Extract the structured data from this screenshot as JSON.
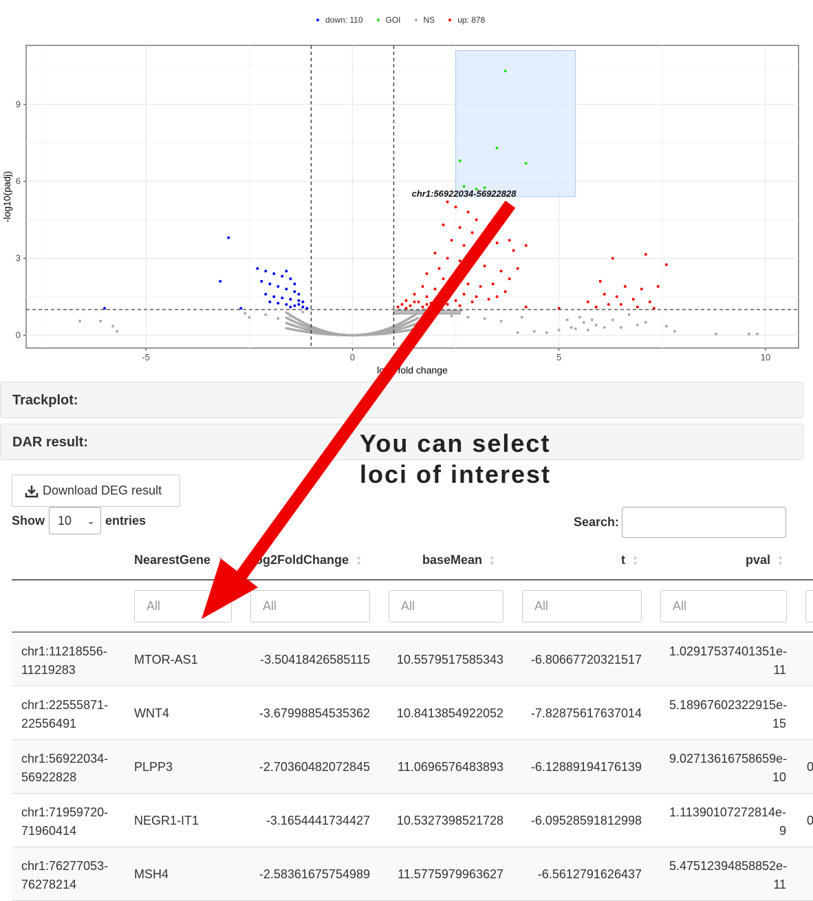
{
  "legend": [
    {
      "label": "down: 110",
      "color": "#0000ff"
    },
    {
      "label": "GOI",
      "color": "#22dd22"
    },
    {
      "label": "NS",
      "color": "#aaaaaa"
    },
    {
      "label": "up: 878",
      "color": "#ff0000"
    }
  ],
  "chart_data": {
    "type": "scatter",
    "xlabel": "log2 fold change",
    "ylabel": "-log10(padj)",
    "xlim": [
      -7.9,
      10.8
    ],
    "ylim": [
      -0.5,
      11.3
    ],
    "xticks": [
      -5,
      0,
      5,
      10
    ],
    "yticks": [
      0,
      3,
      6,
      9
    ],
    "grid": true,
    "thresholds": {
      "x": [
        -1,
        1
      ],
      "y": 1
    },
    "selection_box": {
      "x": [
        2.5,
        5.4
      ],
      "y": [
        5.4,
        11.1
      ]
    },
    "annotation": {
      "text": "chr1:56922034-56922828",
      "x": 2.7,
      "y": 5.4
    },
    "series": [
      {
        "name": "GOI",
        "color": "#22dd22",
        "points": [
          [
            3.7,
            10.3
          ],
          [
            3.5,
            7.3
          ],
          [
            2.6,
            6.8
          ],
          [
            4.2,
            6.7
          ],
          [
            2.7,
            5.8
          ],
          [
            3.0,
            5.7
          ],
          [
            3.2,
            5.75
          ]
        ]
      },
      {
        "name": "down: 110",
        "color": "#0000ff",
        "points": [
          [
            -3.0,
            3.8
          ],
          [
            -3.2,
            2.1
          ],
          [
            -6.0,
            1.05
          ],
          [
            -2.7,
            1.05
          ],
          [
            -2.3,
            2.6
          ],
          [
            -2.1,
            2.5
          ],
          [
            -1.9,
            2.4
          ],
          [
            -1.7,
            2.3
          ],
          [
            -1.5,
            2.2
          ],
          [
            -2.2,
            2.1
          ],
          [
            -2.0,
            2.0
          ],
          [
            -1.8,
            1.9
          ],
          [
            -1.6,
            1.8
          ],
          [
            -1.4,
            1.7
          ],
          [
            -2.1,
            1.6
          ],
          [
            -1.9,
            1.5
          ],
          [
            -1.7,
            1.45
          ],
          [
            -1.5,
            1.4
          ],
          [
            -1.3,
            1.35
          ],
          [
            -2.0,
            1.3
          ],
          [
            -1.8,
            1.25
          ],
          [
            -1.6,
            1.2
          ],
          [
            -1.4,
            1.15
          ],
          [
            -1.2,
            1.1
          ],
          [
            -1.1,
            1.05
          ],
          [
            -1.5,
            1.1
          ],
          [
            -1.3,
            1.2
          ],
          [
            -1.2,
            1.3
          ],
          [
            -1.6,
            2.5
          ],
          [
            -1.4,
            2.0
          ],
          [
            -1.3,
            1.6
          ]
        ]
      },
      {
        "name": "up: 878",
        "color": "#ff0000",
        "points": [
          [
            2.3,
            5.2
          ],
          [
            2.5,
            5.0
          ],
          [
            2.8,
            4.8
          ],
          [
            3.0,
            4.5
          ],
          [
            2.2,
            4.3
          ],
          [
            2.6,
            4.2
          ],
          [
            2.9,
            4.0
          ],
          [
            3.3,
            3.9
          ],
          [
            2.4,
            3.7
          ],
          [
            2.7,
            3.5
          ],
          [
            3.1,
            3.4
          ],
          [
            3.5,
            3.6
          ],
          [
            3.8,
            3.7
          ],
          [
            3.9,
            3.3
          ],
          [
            4.2,
            3.5
          ],
          [
            2.0,
            3.2
          ],
          [
            2.3,
            3.0
          ],
          [
            2.6,
            2.9
          ],
          [
            2.9,
            2.8
          ],
          [
            3.2,
            2.7
          ],
          [
            3.6,
            2.5
          ],
          [
            4.0,
            2.6
          ],
          [
            3.8,
            2.2
          ],
          [
            3.4,
            2.0
          ],
          [
            2.1,
            2.6
          ],
          [
            1.8,
            2.4
          ],
          [
            2.2,
            2.2
          ],
          [
            2.5,
            2.1
          ],
          [
            2.8,
            2.0
          ],
          [
            3.1,
            1.9
          ],
          [
            1.7,
            1.9
          ],
          [
            2.0,
            1.8
          ],
          [
            2.4,
            1.7
          ],
          [
            2.7,
            1.6
          ],
          [
            3.0,
            1.5
          ],
          [
            1.5,
            1.6
          ],
          [
            1.8,
            1.5
          ],
          [
            2.1,
            1.4
          ],
          [
            2.5,
            1.35
          ],
          [
            2.9,
            1.3
          ],
          [
            3.3,
            1.4
          ],
          [
            1.3,
            1.35
          ],
          [
            1.6,
            1.3
          ],
          [
            1.9,
            1.25
          ],
          [
            2.3,
            1.2
          ],
          [
            2.6,
            1.15
          ],
          [
            1.2,
            1.2
          ],
          [
            1.4,
            1.15
          ],
          [
            1.7,
            1.1
          ],
          [
            2.0,
            1.1
          ],
          [
            1.1,
            1.1
          ],
          [
            1.3,
            1.05
          ],
          [
            1.5,
            1.3
          ],
          [
            1.8,
            1.2
          ],
          [
            3.5,
            1.5
          ],
          [
            3.7,
            1.7
          ],
          [
            4.2,
            1.1
          ],
          [
            6.3,
            3.0
          ],
          [
            7.1,
            3.15
          ],
          [
            7.6,
            2.75
          ],
          [
            6.0,
            2.1
          ],
          [
            6.6,
            1.9
          ],
          [
            7.0,
            1.8
          ],
          [
            6.4,
            1.5
          ],
          [
            6.8,
            1.4
          ],
          [
            7.2,
            1.3
          ],
          [
            6.2,
            1.2
          ],
          [
            5.9,
            1.1
          ],
          [
            6.5,
            1.2
          ],
          [
            6.9,
            1.1
          ],
          [
            7.3,
            1.05
          ],
          [
            5.0,
            1.05
          ],
          [
            5.7,
            1.3
          ],
          [
            6.1,
            1.6
          ],
          [
            7.4,
            1.9
          ]
        ]
      },
      {
        "name": "NS",
        "color": "#aaaaaa",
        "points": [
          [
            -6.6,
            0.55
          ],
          [
            -6.1,
            0.55
          ],
          [
            -5.7,
            0.15
          ],
          [
            -5.8,
            0.35
          ],
          [
            -2.6,
            0.85
          ],
          [
            -2.5,
            0.7
          ],
          [
            -2.1,
            0.8
          ],
          [
            -1.8,
            0.65
          ],
          [
            -1.5,
            0.75
          ],
          [
            -1.3,
            0.6
          ],
          [
            -1.2,
            0.9
          ],
          [
            2.4,
            0.75
          ],
          [
            2.8,
            0.7
          ],
          [
            3.2,
            0.65
          ],
          [
            3.6,
            0.55
          ],
          [
            4.1,
            0.7
          ],
          [
            4.0,
            0.1
          ],
          [
            4.4,
            0.15
          ],
          [
            4.7,
            0.1
          ],
          [
            5.0,
            0.2
          ],
          [
            5.3,
            0.3
          ],
          [
            5.6,
            0.5
          ],
          [
            5.9,
            0.4
          ],
          [
            6.3,
            0.6
          ],
          [
            6.7,
            0.8
          ],
          [
            7.1,
            0.5
          ],
          [
            7.6,
            0.35
          ],
          [
            7.8,
            0.15
          ],
          [
            8.8,
            0.05
          ],
          [
            9.6,
            0.05
          ],
          [
            9.8,
            0.05
          ],
          [
            5.2,
            0.6
          ],
          [
            5.5,
            0.7
          ],
          [
            5.8,
            0.6
          ],
          [
            6.1,
            0.3
          ],
          [
            6.5,
            0.3
          ],
          [
            6.9,
            0.4
          ],
          [
            5.4,
            0.25
          ],
          [
            5.7,
            0.2
          ]
        ]
      }
    ]
  },
  "panels": {
    "trackplot": "Trackplot:",
    "dar_result": "DAR result:"
  },
  "download_label": "Download DEG result",
  "show_label": "Show",
  "entries_value": "10",
  "entries_label": "entries",
  "search_label": "Search:",
  "callout": {
    "line1": "You can select",
    "line2": "loci of interest"
  },
  "table": {
    "headers": [
      "NearestGene",
      "log2FoldChange",
      "baseMean",
      "t",
      "pval"
    ],
    "filter_placeholder": "All",
    "rows": [
      {
        "id1": "chr1:11218556-",
        "id2": "11219283",
        "gene": "MTOR-AS1",
        "lfc": "-3.50418426585115",
        "basemean": "10.5579517585343",
        "t": "-6.80667720321517",
        "pval1": "1.02917537401351e-",
        "pval2": "11",
        "edge": ""
      },
      {
        "id1": "chr1:22555871-",
        "id2": "22556491",
        "gene": "WNT4",
        "lfc": "-3.67998854535362",
        "basemean": "10.8413854922052",
        "t": "-7.82875617637014",
        "pval1": "5.18967602322915e-",
        "pval2": "15",
        "edge": ""
      },
      {
        "id1": "chr1:56922034-",
        "id2": "56922828",
        "gene": "PLPP3",
        "lfc": "-2.70360482072845",
        "basemean": "11.0696576483893",
        "t": "-6.12889194176139",
        "pval1": "9.02713616758659e-",
        "pval2": "10",
        "edge": "0"
      },
      {
        "id1": "chr1:71959720-",
        "id2": "71960414",
        "gene": "NEGR1-IT1",
        "lfc": "-3.1654441734427",
        "basemean": "10.5327398521728",
        "t": "-6.09528591812998",
        "pval1": "1.11390107272814e-",
        "pval2": "9",
        "edge": "0"
      },
      {
        "id1": "chr1:76277053-",
        "id2": "76278214",
        "gene": "MSH4",
        "lfc": "-2.58361675754989",
        "basemean": "11.5775979963627",
        "t": "-6.5612791626437",
        "pval1": "5.47512394858852e-",
        "pval2": "11",
        "edge": ""
      }
    ]
  }
}
